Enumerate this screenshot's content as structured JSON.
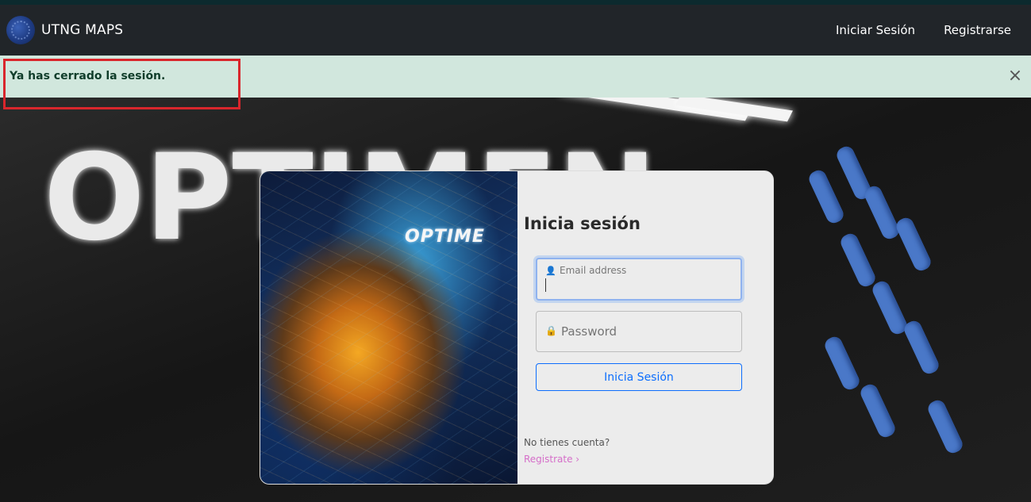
{
  "navbar": {
    "brand_name": "UTNG MAPS",
    "links": [
      {
        "label": "Iniciar Sesión"
      },
      {
        "label": "Registrarse"
      }
    ]
  },
  "alert": {
    "message": "Ya has cerrado la sesión.",
    "close_icon": "×"
  },
  "background": {
    "wall_text": "OPTIMEN"
  },
  "login": {
    "image_brand": "OPTIME",
    "title": "Inicia sesión",
    "email": {
      "label": "Email address",
      "icon": "person-icon"
    },
    "password": {
      "placeholder": "Password",
      "icon": "lock-icon"
    },
    "submit_label": "Inicia Sesión",
    "no_account_text": "No tienes cuenta?",
    "register_label": "Registrate ›"
  },
  "colors": {
    "navbar_bg": "#212529",
    "alert_bg": "#d1e7dd",
    "alert_text": "#0f3d2a",
    "primary": "#0d6efd",
    "register_link": "#d56ec9",
    "highlight": "#d9262c"
  }
}
